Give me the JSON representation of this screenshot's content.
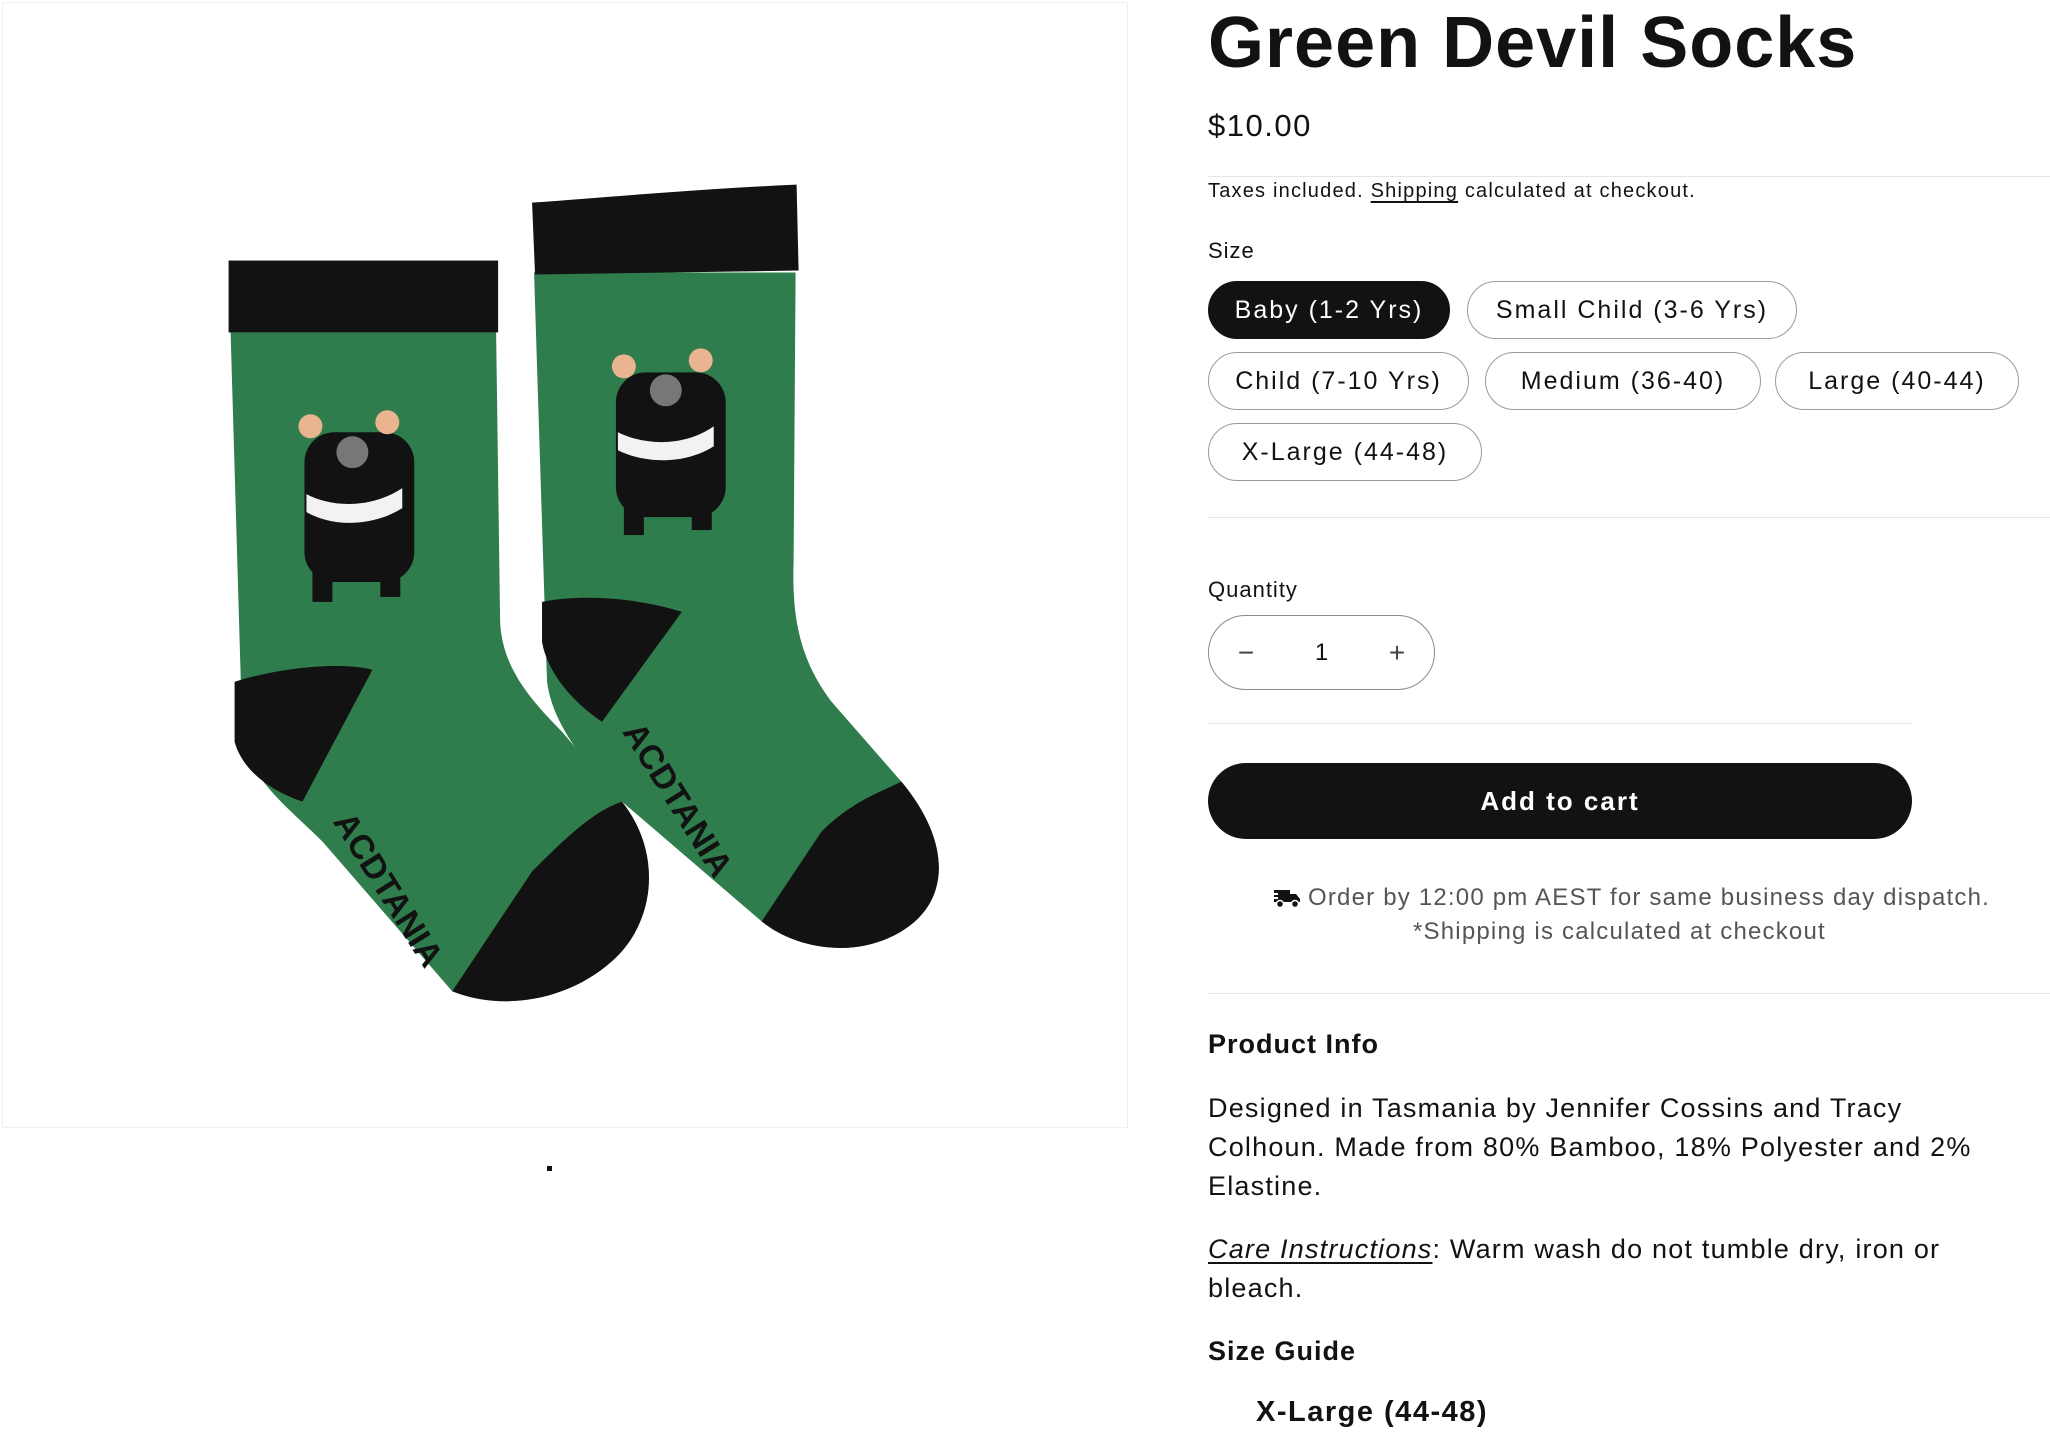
{
  "product": {
    "title": "Green Devil Socks",
    "price": "$10.00",
    "tax_text_before": "Taxes included.",
    "tax_link": "Shipping",
    "tax_text_after": "calculated at checkout."
  },
  "gallery": {
    "image_alt": "Green socks with Tasmanian devil motif",
    "sock_sole_text": "ACDTANIA"
  },
  "size": {
    "label": "Size",
    "selected": "Baby (1-2 Yrs)",
    "options": [
      "Baby (1-2 Yrs)",
      "Small Child (3-6 Yrs)",
      "Child (7-10 Yrs)",
      "Medium (36-40)",
      "Large (40-44)",
      "X-Large (44-48)"
    ]
  },
  "quantity": {
    "label": "Quantity",
    "value": "1",
    "minus": "−",
    "plus": "+"
  },
  "cart": {
    "label": "Add to cart"
  },
  "dispatch": {
    "line1": "Order by 12:00 pm AEST for same business day dispatch.",
    "line2": "*Shipping is calculated at checkout"
  },
  "product_info": {
    "heading": "Product Info",
    "description": "Designed in Tasmania by Jennifer Cossins and Tracy Colhoun. Made from 80% Bamboo, 18% Polyester and 2% Elastine.",
    "care_link": "Care Instructions",
    "care_text": ": Warm wash do not tumble dry, iron or bleach."
  },
  "size_guide": {
    "heading": "Size Guide",
    "item": "X-Large (44-48)"
  },
  "colors": {
    "sock_green": "#2f7d4c",
    "sock_black": "#121212",
    "button_dark": "#121212",
    "devil_ear": "#e9b48f"
  },
  "icons": [
    "truck-icon",
    "minus-icon",
    "plus-icon"
  ]
}
